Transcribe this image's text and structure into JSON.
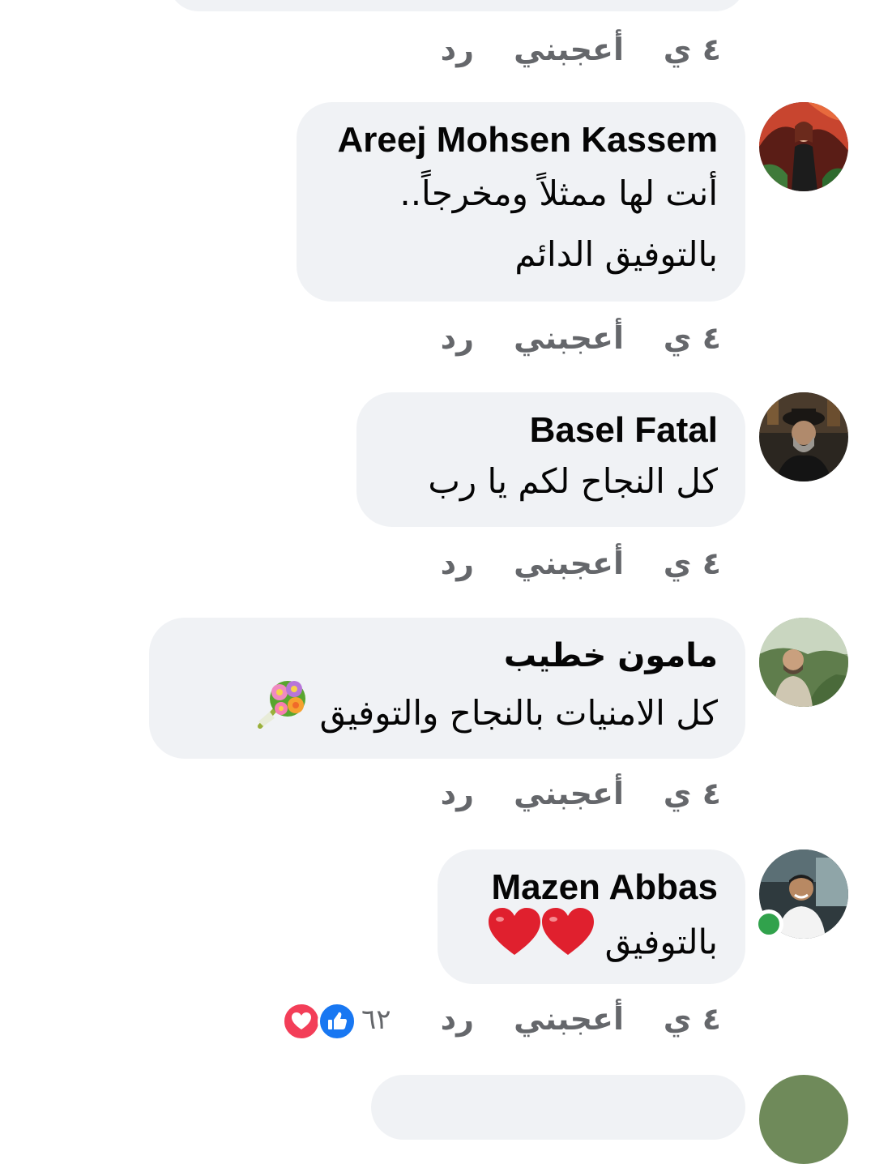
{
  "comments": [
    {
      "author": "",
      "lines": [],
      "actions": {
        "time": "٤ ي",
        "like": "أعجبني",
        "reply": "رد"
      }
    },
    {
      "author": "Areej Mohsen Kassem",
      "lines": [
        "أنت لها ممثلاً ومخرجاً..",
        "بالتوفيق الدائم"
      ],
      "actions": {
        "time": "٤ ي",
        "like": "أعجبني",
        "reply": "رد"
      }
    },
    {
      "author": "Basel Fatal",
      "lines": [
        "كل النجاح لكم يا رب"
      ],
      "actions": {
        "time": "٤ ي",
        "like": "أعجبني",
        "reply": "رد"
      }
    },
    {
      "author": "مامون خطيب",
      "lines": [
        "كل الامنيات بالنجاح والتوفيق"
      ],
      "emoji": "bouquet-icon",
      "actions": {
        "time": "٤ ي",
        "like": "أعجبني",
        "reply": "رد"
      }
    },
    {
      "author": "Mazen Abbas",
      "lines": [
        "بالتوفيق"
      ],
      "emoji": "red-heart-icon",
      "online": true,
      "actions": {
        "time": "٤ ي",
        "like": "أعجبني",
        "reply": "رد"
      },
      "reactions": {
        "count": "٦٢",
        "icons": [
          "like-icon",
          "love-icon"
        ]
      }
    }
  ],
  "colors": {
    "bubble_bg": "#f0f2f5",
    "meta_text": "#65676b",
    "like_blue": "#1877f2",
    "love_red": "#f33e58",
    "online_green": "#31a24c"
  }
}
